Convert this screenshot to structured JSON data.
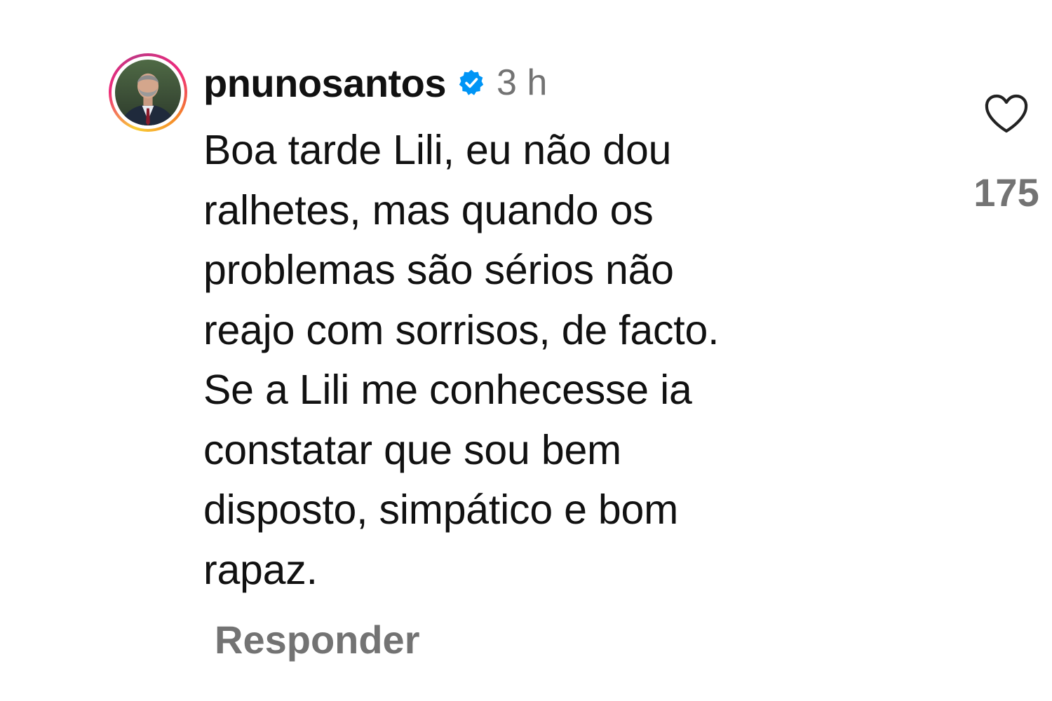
{
  "comment": {
    "username": "pnunosantos",
    "verified": true,
    "timestamp": "3 h",
    "text": "Boa tarde Lili, eu não dou\nralhetes, mas quando os\nproblemas são sérios não\nreajo com sorrisos, de facto.\nSe a Lili me conhece­sse ia\nconstatar que sou bem\ndisposto, simpático e bom\nrapaz.",
    "like_count": "175",
    "reply_label": "Responder",
    "icons": {
      "avatar": "profile-photo",
      "verified": "verified-badge-icon",
      "like": "heart-icon"
    },
    "colors": {
      "verified_badge": "#0095f6",
      "secondary_text": "#737373",
      "primary_text": "#111111"
    }
  }
}
